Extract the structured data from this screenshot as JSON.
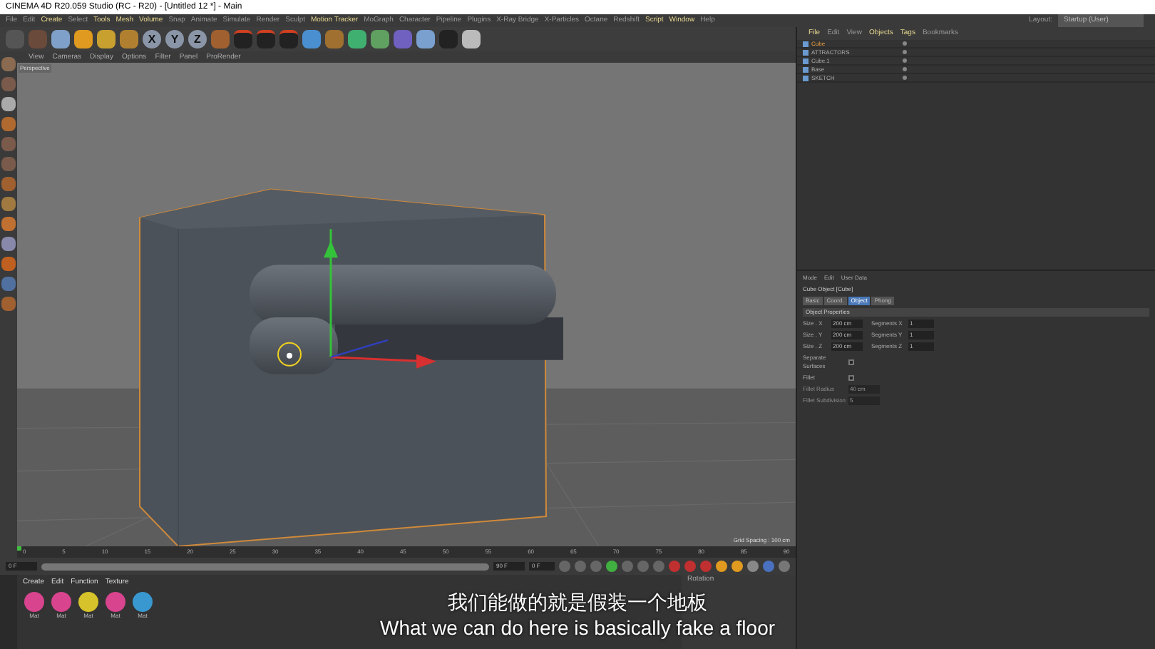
{
  "window": {
    "title": "CINEMA 4D R20.059 Studio (RC - R20) - [Untitled 12 *] - Main"
  },
  "menu_bar": {
    "items": [
      {
        "label": "File",
        "highlighted": false
      },
      {
        "label": "Edit",
        "highlighted": false
      },
      {
        "label": "Create",
        "highlighted": true
      },
      {
        "label": "Select",
        "highlighted": false
      },
      {
        "label": "Tools",
        "highlighted": true
      },
      {
        "label": "Mesh",
        "highlighted": true
      },
      {
        "label": "Volume",
        "highlighted": true
      },
      {
        "label": "Snap",
        "highlighted": false
      },
      {
        "label": "Animate",
        "highlighted": false
      },
      {
        "label": "Simulate",
        "highlighted": false
      },
      {
        "label": "Render",
        "highlighted": false
      },
      {
        "label": "Sculpt",
        "highlighted": false
      },
      {
        "label": "Motion Tracker",
        "highlighted": true
      },
      {
        "label": "MoGraph",
        "highlighted": false
      },
      {
        "label": "Character",
        "highlighted": false
      },
      {
        "label": "Pipeline",
        "highlighted": false
      },
      {
        "label": "Plugins",
        "highlighted": false
      },
      {
        "label": "X-Ray Bridge",
        "highlighted": false
      },
      {
        "label": "X-Particles",
        "highlighted": false
      },
      {
        "label": "Octane",
        "highlighted": false
      },
      {
        "label": "Redshift",
        "highlighted": false
      },
      {
        "label": "Script",
        "highlighted": true
      },
      {
        "label": "Window",
        "highlighted": true
      },
      {
        "label": "Help",
        "highlighted": false
      }
    ],
    "layout_label": "Layout:",
    "layout_value": "Startup (User)"
  },
  "toolbar": {
    "axis_buttons": [
      "X",
      "Y",
      "Z"
    ]
  },
  "viewport": {
    "menu": [
      "View",
      "Cameras",
      "Display",
      "Options",
      "Filter",
      "Panel",
      "ProRender"
    ],
    "view_name": "Perspective",
    "grid_spacing": "Grid Spacing : 100 cm"
  },
  "object_manager": {
    "menu": [
      {
        "label": "File",
        "highlighted": true
      },
      {
        "label": "Edit",
        "highlighted": false
      },
      {
        "label": "View",
        "highlighted": false
      },
      {
        "label": "Objects",
        "highlighted": true
      },
      {
        "label": "Tags",
        "highlighted": true
      },
      {
        "label": "Bookmarks",
        "highlighted": false
      }
    ],
    "objects": [
      {
        "name": "Cube",
        "selected": true
      },
      {
        "name": "ATTRACTORS",
        "selected": false
      },
      {
        "name": "Cube.1",
        "selected": false
      },
      {
        "name": "Base",
        "selected": false
      },
      {
        "name": "SKETCH",
        "selected": false
      }
    ]
  },
  "attributes": {
    "menu": [
      "Mode",
      "Edit",
      "User Data"
    ],
    "object_title": "Cube Object [Cube]",
    "tabs": [
      {
        "label": "Basic",
        "selected": false
      },
      {
        "label": "Coord.",
        "selected": false
      },
      {
        "label": "Object",
        "selected": true
      },
      {
        "label": "Phong",
        "selected": false
      }
    ],
    "section": "Object Properties",
    "rows": [
      {
        "label": "Size . X",
        "value": "200 cm",
        "seg_label": "Segments X",
        "seg_value": "1"
      },
      {
        "label": "Size . Y",
        "value": "200 cm",
        "seg_label": "Segments Y",
        "seg_value": "1"
      },
      {
        "label": "Size . Z",
        "value": "200 cm",
        "seg_label": "Segments Z",
        "seg_value": "1"
      }
    ],
    "options": [
      {
        "label": "Separate Surfaces",
        "kind": "checkbox",
        "checked": false,
        "disabled": false
      },
      {
        "label": "Fillet",
        "kind": "checkbox",
        "checked": false,
        "disabled": false
      },
      {
        "label": "Fillet Radius",
        "kind": "field",
        "value": "40 cm",
        "disabled": true
      },
      {
        "label": "Fillet Subdivision",
        "kind": "field",
        "value": "5",
        "disabled": true
      }
    ]
  },
  "timeline": {
    "ticks": [
      "0",
      "5",
      "10",
      "15",
      "20",
      "25",
      "30",
      "35",
      "40",
      "45",
      "50",
      "55",
      "60",
      "65",
      "70",
      "75",
      "80",
      "85",
      "90"
    ],
    "start": "0 F",
    "end": "90 F",
    "current": "0 F",
    "range_slider": {
      "level": 1
    }
  },
  "material_manager": {
    "menu": [
      "Create",
      "Edit",
      "Function",
      "Texture"
    ],
    "materials": [
      {
        "name": "Mat",
        "color": "#d8448e"
      },
      {
        "name": "Mat",
        "color": "#d8448e"
      },
      {
        "name": "Mat",
        "color": "#d6c22a"
      },
      {
        "name": "Mat",
        "color": "#d8448e"
      },
      {
        "name": "Mat",
        "color": "#3a98d0"
      }
    ]
  },
  "coordinates": {
    "heading": "Rotation"
  },
  "subtitles": [
    "我们能做的就是假装一个地板",
    "What we can do here is basically fake a floor"
  ]
}
